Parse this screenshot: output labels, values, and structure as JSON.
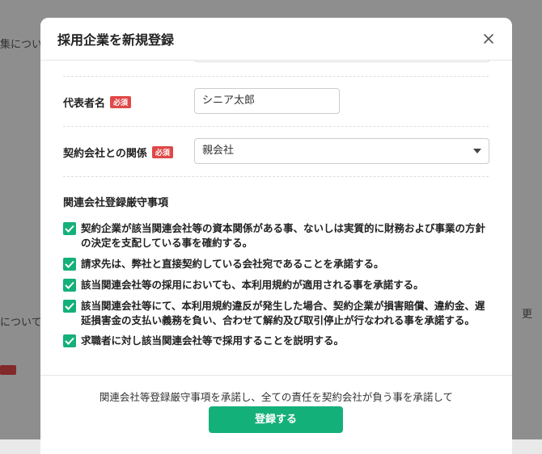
{
  "background": {
    "fragment_1": "集について",
    "fragment_2": "について",
    "fragment_3": "更"
  },
  "modal": {
    "title": "採用企業を新規登録",
    "close_icon": "close-icon"
  },
  "form": {
    "representative": {
      "label": "代表者名",
      "required_badge": "必須",
      "value": "シニア太郎"
    },
    "relationship": {
      "label": "契約会社との関係",
      "required_badge": "必須",
      "selected": "親会社"
    }
  },
  "compliance": {
    "title": "関連会社登録厳守事項",
    "items": [
      {
        "text": "契約企業が該当関連会社等の資本関係がある事、ないしは実質的に財務および事業の方針の決定を支配している事を確約する。",
        "checked": true
      },
      {
        "text": "請求先は、弊社と直接契約している会社宛であることを承諾する。",
        "checked": true
      },
      {
        "text": "該当関連会社等の採用においても、本利用規約が適用される事を承諾する。",
        "checked": true
      },
      {
        "text": "該当関連会社等にて、本利用規約違反が発生した場合、契約企業が損害賠償、違約金、遅延損害金の支払い義務を負い、合わせて解約及び取引停止が行なわれる事を承諾する。",
        "checked": true
      },
      {
        "text": "求職者に対し該当関連会社等で採用することを説明する。",
        "checked": true
      }
    ]
  },
  "footer": {
    "note": "関連会社等登録厳守事項を承諾し、全ての責任を契約会社が負う事を承諾して",
    "submit_label": "登録する"
  },
  "colors": {
    "accent": "#14b07a",
    "required": "#e04848"
  }
}
